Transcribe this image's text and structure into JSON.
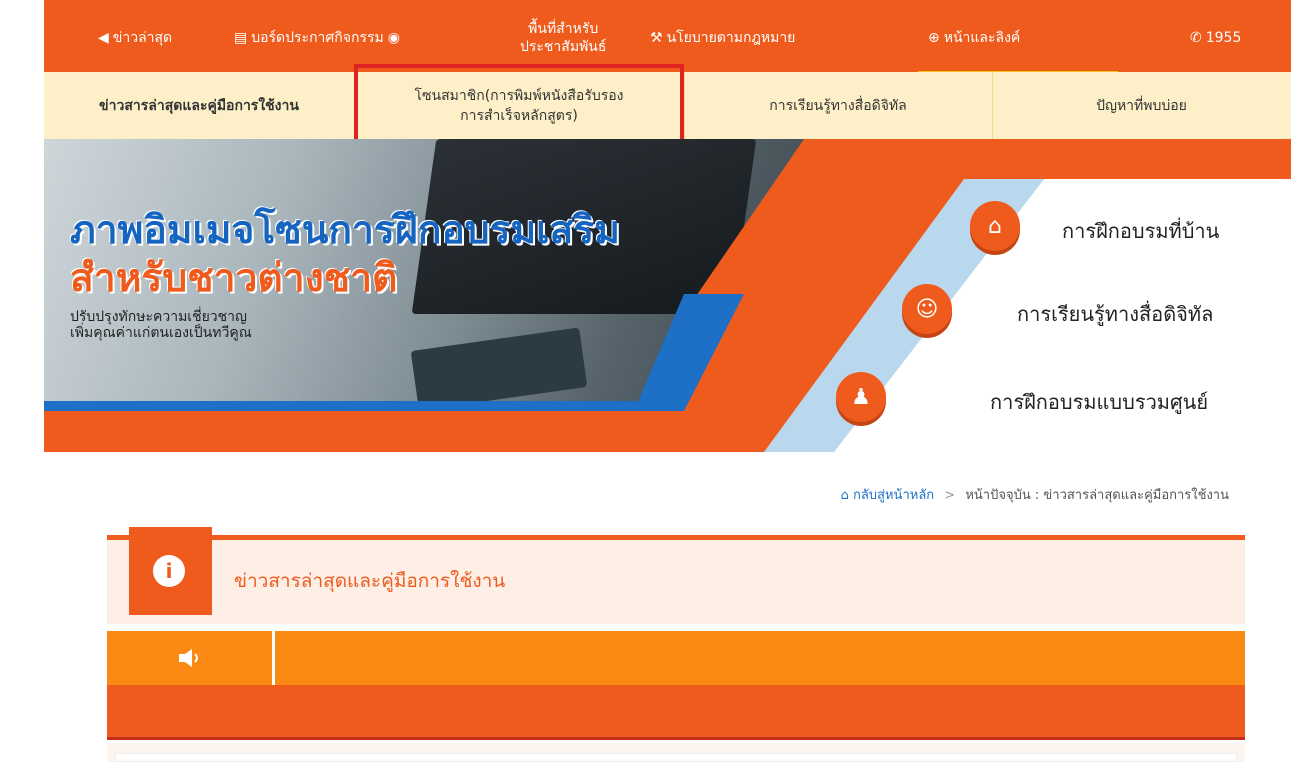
{
  "topnav": {
    "items": [
      {
        "icon": "megaphone-icon",
        "glyph": "📢",
        "label": "ข่าวล่าสุด"
      },
      {
        "icon": "newspaper-icon",
        "glyph": "📰",
        "label": "บอร์ดประกาศกิจกรรม",
        "extra": "📡"
      },
      {
        "line1": "พื้นที่สำหรับ",
        "line2": "ประชาสัมพันธ์"
      },
      {
        "icon": "gavel-icon",
        "glyph": "🔨",
        "label": "นโยบายตามกฎหมาย"
      },
      {
        "icon": "lifebuoy-icon",
        "glyph": "⊕",
        "label": "หน้าและลิงค์"
      },
      {
        "icon": "whatsapp-icon",
        "glyph": "☏",
        "label": "1955"
      }
    ]
  },
  "subnav": {
    "items": [
      {
        "label": "ข่าวสารล่าสุดและคู่มือการใช้งาน"
      },
      {
        "line1": "โซนสมาชิก(การพิมพ์หนังสือรับรอง",
        "line2": "การสำเร็จหลักสูตร)"
      },
      {
        "label": "การเรียนรู้ทางสื่อดิจิทัล"
      },
      {
        "label": "ปัญหาที่พบบ่อย"
      }
    ]
  },
  "banner": {
    "headline1": "ภาพอิมเมจโซนการฝึกอบรมเสริม",
    "headline2": "สำหรับชาวต่างชาติ",
    "subline1": "ปรับปรุงทักษะความเชี่ยวชาญ",
    "subline2": "เพิ่มคุณค่าแก่ตนเองเป็นทวีคูณ",
    "features": [
      {
        "label": "การฝึกอบรมที่บ้าน",
        "glyph": "🏠"
      },
      {
        "label": "การเรียนรู้ทางสื่อดิจิทัล",
        "glyph": "👤"
      },
      {
        "label": "การฝึกอบรมแบบรวมศูนย์",
        "glyph": "👥"
      }
    ]
  },
  "breadcrumb": {
    "home": "กลับสู่หน้าหลัก",
    "separator": ">",
    "current_prefix": "หน้าปัจจุบัน :",
    "current": "ข่าวสารล่าสุดและคู่มือการใช้งาน"
  },
  "panel": {
    "info_glyph": "i",
    "title": "ข่าวสารล่าสุดและคู่มือการใช้งาน",
    "speaker_glyph": "🔈"
  }
}
